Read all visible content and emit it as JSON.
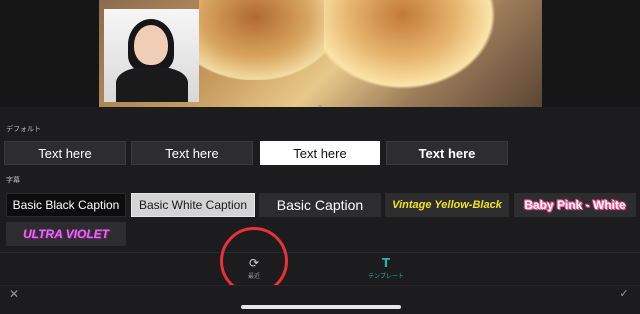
{
  "preview": {
    "chevron_glyph": "⌃"
  },
  "sections": {
    "default_label": "デフォルト",
    "caption_label": "字幕"
  },
  "text_tiles": [
    {
      "label": "Text here"
    },
    {
      "label": "Text here"
    },
    {
      "label": "Text here"
    },
    {
      "label": "Text here"
    }
  ],
  "caption_tiles": [
    {
      "label": "Basic Black Caption"
    },
    {
      "label": "Basic White Caption"
    },
    {
      "label": "Basic Caption"
    },
    {
      "label": "Vintage Yellow-Black"
    },
    {
      "label": "Baby Pink - White"
    },
    {
      "label": "ULTRA VIOLET"
    }
  ],
  "tabs": {
    "recent": {
      "label": "最近",
      "icon": "refresh-icon",
      "glyph": "⟳"
    },
    "template": {
      "label": "テンプレート",
      "icon": "text-template-icon",
      "glyph": "T"
    }
  },
  "bottom_bar": {
    "close_glyph": "✕",
    "confirm_glyph": "✓"
  },
  "colors": {
    "highlight_ring": "#e8313a",
    "template_accent": "#2bb3a3"
  }
}
